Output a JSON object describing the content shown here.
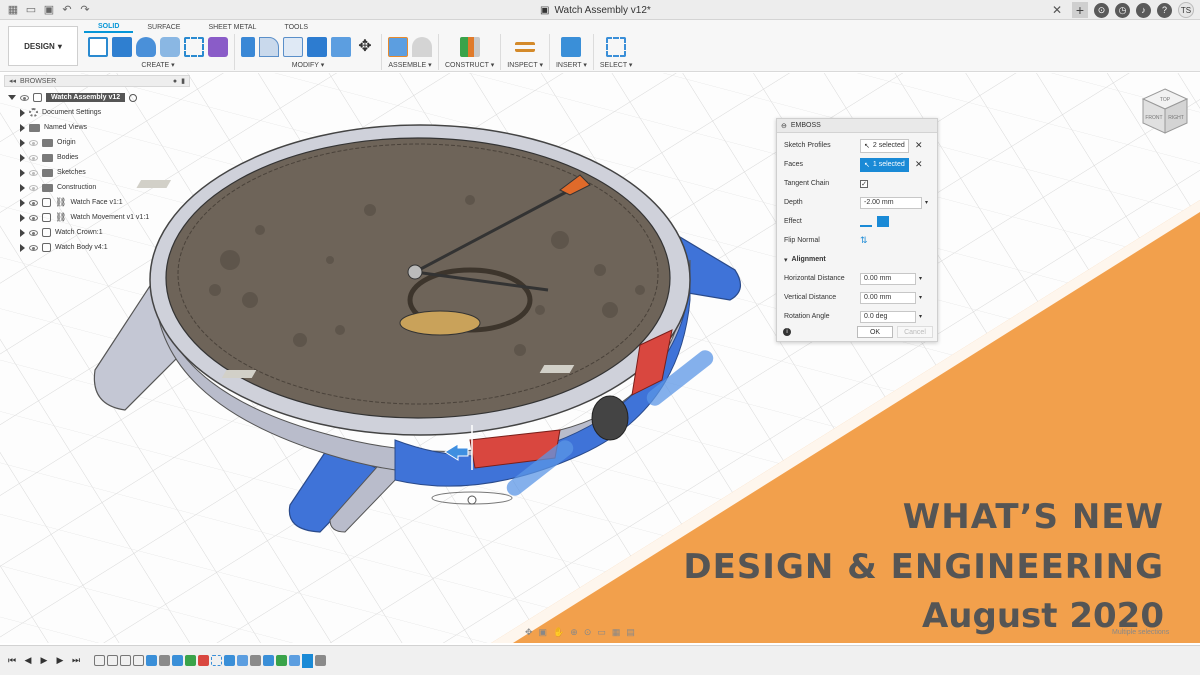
{
  "titlebar": {
    "document_title": "Watch Assembly v12*",
    "user_initials": "TS"
  },
  "toolbar": {
    "workspace": "DESIGN",
    "tabs": [
      {
        "label": "SOLID",
        "active": true
      },
      {
        "label": "SURFACE",
        "active": false
      },
      {
        "label": "SHEET METAL",
        "active": false
      },
      {
        "label": "TOOLS",
        "active": false
      }
    ],
    "groups": [
      "CREATE",
      "MODIFY",
      "ASSEMBLE",
      "CONSTRUCT",
      "INSPECT",
      "INSERT",
      "SELECT"
    ]
  },
  "browser": {
    "header": "BROWSER",
    "root": "Watch Assembly v12",
    "items": [
      {
        "label": "Document Settings",
        "icon": "gear-icon"
      },
      {
        "label": "Named Views",
        "icon": "folder-icon"
      },
      {
        "label": "Origin",
        "icon": "folder-icon"
      },
      {
        "label": "Bodies",
        "icon": "folder-icon"
      },
      {
        "label": "Sketches",
        "icon": "folder-icon"
      },
      {
        "label": "Construction",
        "icon": "folder-icon"
      },
      {
        "label": "Watch Face v1:1",
        "icon": "linked-component-icon"
      },
      {
        "label": "Watch Movement v1 v1:1",
        "icon": "linked-component-icon"
      },
      {
        "label": "Watch Crown:1",
        "icon": "component-icon"
      },
      {
        "label": "Watch Body v4:1",
        "icon": "component-icon"
      }
    ]
  },
  "emboss": {
    "title": "EMBOSS",
    "sketch_profiles_label": "Sketch Profiles",
    "sketch_profiles_value": "2 selected",
    "faces_label": "Faces",
    "faces_value": "1 selected",
    "tangent_chain_label": "Tangent Chain",
    "tangent_chain_checked": true,
    "depth_label": "Depth",
    "depth_value": "-2.00 mm",
    "effect_label": "Effect",
    "flip_normal_label": "Flip Normal",
    "alignment_label": "Alignment",
    "horizontal_distance_label": "Horizontal Distance",
    "horizontal_distance_value": "0.00 mm",
    "vertical_distance_label": "Vertical Distance",
    "vertical_distance_value": "0.00 mm",
    "rotation_angle_label": "Rotation Angle",
    "rotation_angle_value": "0.0 deg",
    "ok_label": "OK",
    "cancel_label": "Cancel"
  },
  "viewcube": {
    "top": "TOP",
    "front": "FRONT",
    "right": "RIGHT"
  },
  "overlay": {
    "line1": "WHAT’S NEW",
    "line2": "DESIGN & ENGINEERING",
    "line3": "August 2020",
    "accent_color": "#f2a04c"
  },
  "status": {
    "selection_text": "Multiple selections"
  },
  "colors": {
    "selection_blue": "#1a8ad6",
    "model_blue": "#3f73d8",
    "model_gray": "#b9bccb",
    "dial": "#6e6459"
  }
}
